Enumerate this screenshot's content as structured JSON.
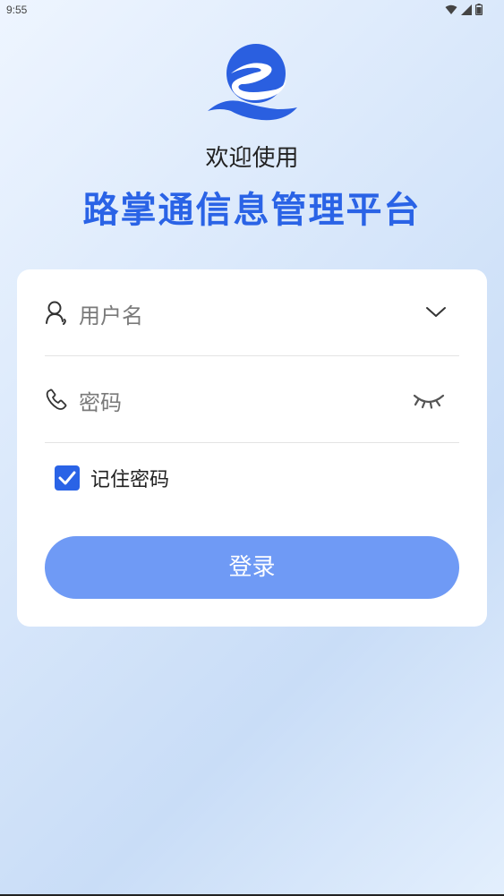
{
  "status_bar": {
    "time": "9:55",
    "icons": [
      "wifi-icon",
      "signal-icon",
      "battery-icon"
    ]
  },
  "header": {
    "welcome": "欢迎使用",
    "title": "路掌通信息管理平台",
    "logo_icon": "road-logo-icon"
  },
  "login_form": {
    "username": {
      "placeholder": "用户名",
      "icon": "user-icon",
      "trailing_icon": "chevron-down-icon"
    },
    "password": {
      "placeholder": "密码",
      "icon": "phone-icon",
      "trailing_icon": "eye-closed-icon"
    },
    "remember": {
      "label": "记住密码",
      "checked": true
    },
    "login_label": "登录"
  },
  "colors": {
    "brand_blue": "#2a63e6",
    "button_blue": "#6f9af5",
    "background": "#dbe9fb"
  }
}
